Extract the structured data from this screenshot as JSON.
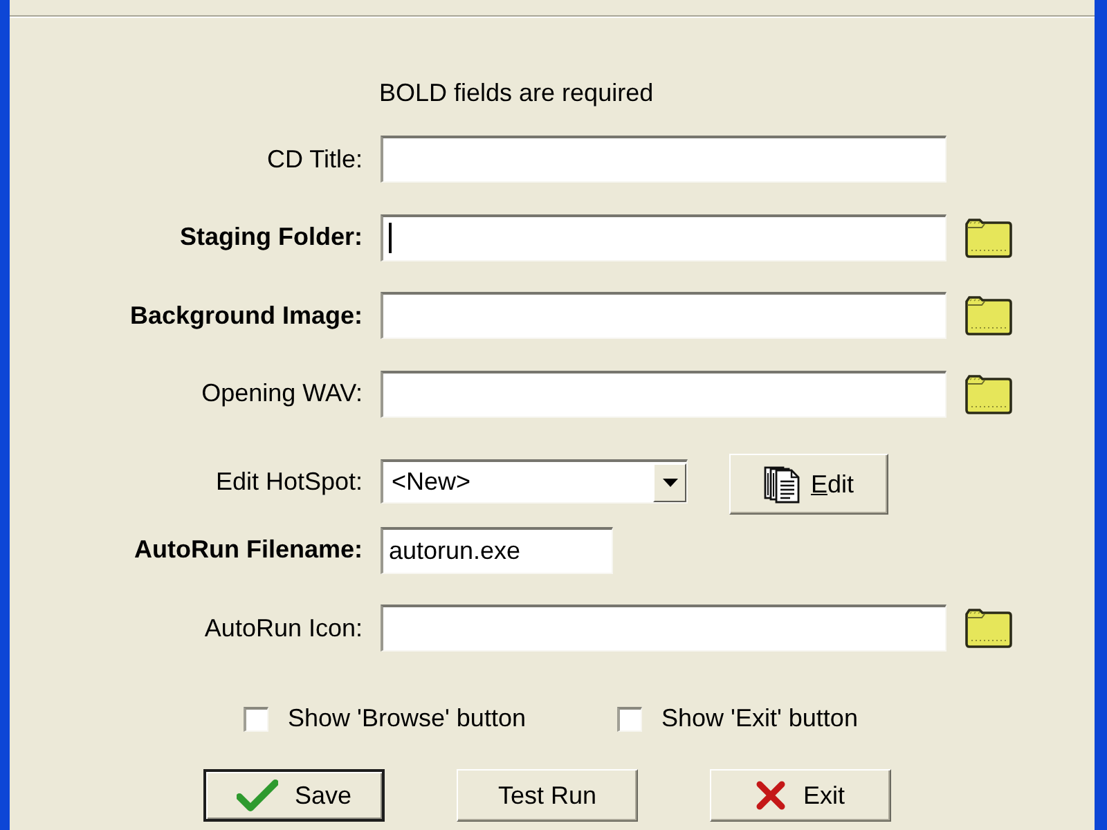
{
  "note": "BOLD fields are required",
  "fields": [
    {
      "kind": "text",
      "label": "CD Title:",
      "required": false,
      "focused": false,
      "browse": false
    },
    {
      "kind": "text",
      "label": "Staging Folder:",
      "required": true,
      "focused": true,
      "browse": true
    },
    {
      "kind": "text",
      "label": "Background Image:",
      "required": true,
      "focused": false,
      "browse": true
    },
    {
      "kind": "text",
      "label": "Opening WAV:",
      "required": false,
      "focused": false,
      "browse": true
    },
    {
      "kind": "dropdown",
      "label": "Edit HotSpot:",
      "required": false,
      "value": "<New>",
      "button": "Edit"
    },
    {
      "kind": "short",
      "label": "AutoRun Filename:",
      "required": true,
      "focused": false,
      "value": "autorun.exe",
      "browse": false
    },
    {
      "kind": "text",
      "label": "AutoRun Icon:",
      "required": false,
      "focused": false,
      "browse": true
    }
  ],
  "checkboxes": [
    {
      "label": "Show 'Browse' button",
      "checked": false
    },
    {
      "label": "Show 'Exit' button",
      "checked": false
    }
  ],
  "buttons": [
    {
      "kind": "confirm",
      "label": "Save",
      "default": true
    },
    {
      "kind": "plain",
      "label": "Test Run",
      "default": false
    },
    {
      "kind": "cancel",
      "label": "Exit",
      "default": false
    }
  ]
}
